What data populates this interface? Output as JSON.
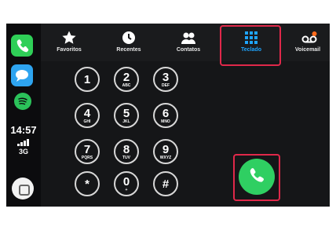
{
  "status": {
    "time": "14:57",
    "network": "3G"
  },
  "tabs": [
    {
      "label": "Favoritos",
      "icon": "star-icon"
    },
    {
      "label": "Recentes",
      "icon": "clock-icon"
    },
    {
      "label": "Contatos",
      "icon": "contacts-icon"
    },
    {
      "label": "Teclado",
      "icon": "keypad-icon",
      "active": true
    },
    {
      "label": "Voicemail",
      "icon": "voicemail-icon",
      "badge": true
    }
  ],
  "keypad": [
    {
      "digit": "1",
      "letters": ""
    },
    {
      "digit": "2",
      "letters": "ABC"
    },
    {
      "digit": "3",
      "letters": "DEF"
    },
    {
      "digit": "4",
      "letters": "GHI"
    },
    {
      "digit": "5",
      "letters": "JKL"
    },
    {
      "digit": "6",
      "letters": "MNO"
    },
    {
      "digit": "7",
      "letters": "PQRS"
    },
    {
      "digit": "8",
      "letters": "TUV"
    },
    {
      "digit": "9",
      "letters": "WXYZ"
    },
    {
      "digit": "*",
      "letters": ""
    },
    {
      "digit": "0",
      "letters": "+"
    },
    {
      "digit": "#",
      "letters": ""
    }
  ],
  "colors": {
    "accent": "#1fa5ff",
    "call": "#2fcf62",
    "highlight": "#e0284a",
    "phone_app": "#2fcf57"
  }
}
